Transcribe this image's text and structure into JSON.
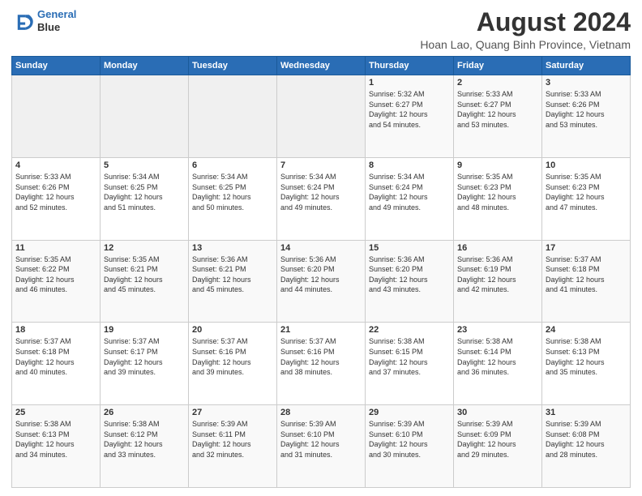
{
  "logo": {
    "line1": "General",
    "line2": "Blue"
  },
  "title": "August 2024",
  "subtitle": "Hoan Lao, Quang Binh Province, Vietnam",
  "columns": [
    "Sunday",
    "Monday",
    "Tuesday",
    "Wednesday",
    "Thursday",
    "Friday",
    "Saturday"
  ],
  "weeks": [
    [
      {
        "day": "",
        "content": ""
      },
      {
        "day": "",
        "content": ""
      },
      {
        "day": "",
        "content": ""
      },
      {
        "day": "",
        "content": ""
      },
      {
        "day": "1",
        "content": "Sunrise: 5:32 AM\nSunset: 6:27 PM\nDaylight: 12 hours\nand 54 minutes."
      },
      {
        "day": "2",
        "content": "Sunrise: 5:33 AM\nSunset: 6:27 PM\nDaylight: 12 hours\nand 53 minutes."
      },
      {
        "day": "3",
        "content": "Sunrise: 5:33 AM\nSunset: 6:26 PM\nDaylight: 12 hours\nand 53 minutes."
      }
    ],
    [
      {
        "day": "4",
        "content": "Sunrise: 5:33 AM\nSunset: 6:26 PM\nDaylight: 12 hours\nand 52 minutes."
      },
      {
        "day": "5",
        "content": "Sunrise: 5:34 AM\nSunset: 6:25 PM\nDaylight: 12 hours\nand 51 minutes."
      },
      {
        "day": "6",
        "content": "Sunrise: 5:34 AM\nSunset: 6:25 PM\nDaylight: 12 hours\nand 50 minutes."
      },
      {
        "day": "7",
        "content": "Sunrise: 5:34 AM\nSunset: 6:24 PM\nDaylight: 12 hours\nand 49 minutes."
      },
      {
        "day": "8",
        "content": "Sunrise: 5:34 AM\nSunset: 6:24 PM\nDaylight: 12 hours\nand 49 minutes."
      },
      {
        "day": "9",
        "content": "Sunrise: 5:35 AM\nSunset: 6:23 PM\nDaylight: 12 hours\nand 48 minutes."
      },
      {
        "day": "10",
        "content": "Sunrise: 5:35 AM\nSunset: 6:23 PM\nDaylight: 12 hours\nand 47 minutes."
      }
    ],
    [
      {
        "day": "11",
        "content": "Sunrise: 5:35 AM\nSunset: 6:22 PM\nDaylight: 12 hours\nand 46 minutes."
      },
      {
        "day": "12",
        "content": "Sunrise: 5:35 AM\nSunset: 6:21 PM\nDaylight: 12 hours\nand 45 minutes."
      },
      {
        "day": "13",
        "content": "Sunrise: 5:36 AM\nSunset: 6:21 PM\nDaylight: 12 hours\nand 45 minutes."
      },
      {
        "day": "14",
        "content": "Sunrise: 5:36 AM\nSunset: 6:20 PM\nDaylight: 12 hours\nand 44 minutes."
      },
      {
        "day": "15",
        "content": "Sunrise: 5:36 AM\nSunset: 6:20 PM\nDaylight: 12 hours\nand 43 minutes."
      },
      {
        "day": "16",
        "content": "Sunrise: 5:36 AM\nSunset: 6:19 PM\nDaylight: 12 hours\nand 42 minutes."
      },
      {
        "day": "17",
        "content": "Sunrise: 5:37 AM\nSunset: 6:18 PM\nDaylight: 12 hours\nand 41 minutes."
      }
    ],
    [
      {
        "day": "18",
        "content": "Sunrise: 5:37 AM\nSunset: 6:18 PM\nDaylight: 12 hours\nand 40 minutes."
      },
      {
        "day": "19",
        "content": "Sunrise: 5:37 AM\nSunset: 6:17 PM\nDaylight: 12 hours\nand 39 minutes."
      },
      {
        "day": "20",
        "content": "Sunrise: 5:37 AM\nSunset: 6:16 PM\nDaylight: 12 hours\nand 39 minutes."
      },
      {
        "day": "21",
        "content": "Sunrise: 5:37 AM\nSunset: 6:16 PM\nDaylight: 12 hours\nand 38 minutes."
      },
      {
        "day": "22",
        "content": "Sunrise: 5:38 AM\nSunset: 6:15 PM\nDaylight: 12 hours\nand 37 minutes."
      },
      {
        "day": "23",
        "content": "Sunrise: 5:38 AM\nSunset: 6:14 PM\nDaylight: 12 hours\nand 36 minutes."
      },
      {
        "day": "24",
        "content": "Sunrise: 5:38 AM\nSunset: 6:13 PM\nDaylight: 12 hours\nand 35 minutes."
      }
    ],
    [
      {
        "day": "25",
        "content": "Sunrise: 5:38 AM\nSunset: 6:13 PM\nDaylight: 12 hours\nand 34 minutes."
      },
      {
        "day": "26",
        "content": "Sunrise: 5:38 AM\nSunset: 6:12 PM\nDaylight: 12 hours\nand 33 minutes."
      },
      {
        "day": "27",
        "content": "Sunrise: 5:39 AM\nSunset: 6:11 PM\nDaylight: 12 hours\nand 32 minutes."
      },
      {
        "day": "28",
        "content": "Sunrise: 5:39 AM\nSunset: 6:10 PM\nDaylight: 12 hours\nand 31 minutes."
      },
      {
        "day": "29",
        "content": "Sunrise: 5:39 AM\nSunset: 6:10 PM\nDaylight: 12 hours\nand 30 minutes."
      },
      {
        "day": "30",
        "content": "Sunrise: 5:39 AM\nSunset: 6:09 PM\nDaylight: 12 hours\nand 29 minutes."
      },
      {
        "day": "31",
        "content": "Sunrise: 5:39 AM\nSunset: 6:08 PM\nDaylight: 12 hours\nand 28 minutes."
      }
    ]
  ]
}
